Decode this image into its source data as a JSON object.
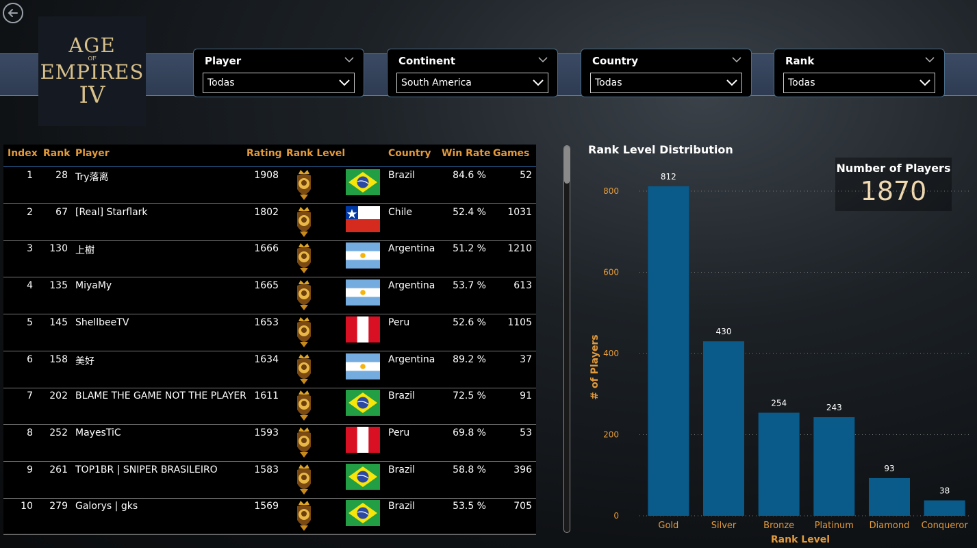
{
  "logo": {
    "line1": "AGE",
    "line2": "OF",
    "line3": "EMPIRES",
    "line4": "IV"
  },
  "filters": [
    {
      "title": "Player",
      "value": "Todas"
    },
    {
      "title": "Continent",
      "value": "South America"
    },
    {
      "title": "Country",
      "value": "Todas"
    },
    {
      "title": "Rank",
      "value": "Todas"
    }
  ],
  "table": {
    "headers": [
      "Index",
      "Rank",
      "Player",
      "Rating",
      "Rank Level",
      "Country",
      "Win Rate",
      "Games"
    ],
    "rows": [
      {
        "index": "1",
        "rank": "28",
        "player": "Try落离",
        "rating": "1908",
        "flag": "brazil",
        "country": "Brazil",
        "win_rate": "84.6 %",
        "games": "52"
      },
      {
        "index": "2",
        "rank": "67",
        "player": "[Real] Starflark",
        "rating": "1802",
        "flag": "chile",
        "country": "Chile",
        "win_rate": "52.4 %",
        "games": "1031"
      },
      {
        "index": "3",
        "rank": "130",
        "player": "上樹",
        "rating": "1666",
        "flag": "argentina",
        "country": "Argentina",
        "win_rate": "51.2 %",
        "games": "1210"
      },
      {
        "index": "4",
        "rank": "135",
        "player": "MiyaMy",
        "rating": "1665",
        "flag": "argentina",
        "country": "Argentina",
        "win_rate": "53.7 %",
        "games": "613"
      },
      {
        "index": "5",
        "rank": "145",
        "player": "ShellbeeTV",
        "rating": "1653",
        "flag": "peru",
        "country": "Peru",
        "win_rate": "52.6 %",
        "games": "1105"
      },
      {
        "index": "6",
        "rank": "158",
        "player": "美好",
        "rating": "1634",
        "flag": "argentina",
        "country": "Argentina",
        "win_rate": "89.2 %",
        "games": "37"
      },
      {
        "index": "7",
        "rank": "202",
        "player": "BLAME THE GAME NOT THE PLAYER",
        "rating": "1611",
        "flag": "brazil",
        "country": "Brazil",
        "win_rate": "72.5 %",
        "games": "91"
      },
      {
        "index": "8",
        "rank": "252",
        "player": "MayesTiC",
        "rating": "1593",
        "flag": "peru",
        "country": "Peru",
        "win_rate": "69.8 %",
        "games": "53"
      },
      {
        "index": "9",
        "rank": "261",
        "player": "TOP1BR | SNIPER BRASILEIRO",
        "rating": "1583",
        "flag": "brazil",
        "country": "Brazil",
        "win_rate": "58.8 %",
        "games": "396"
      },
      {
        "index": "10",
        "rank": "279",
        "player": "Galorys | gks",
        "rating": "1569",
        "flag": "brazil",
        "country": "Brazil",
        "win_rate": "53.5 %",
        "games": "705"
      }
    ]
  },
  "kpi": {
    "label": "Number of Players",
    "value": "1870"
  },
  "chart_data": {
    "type": "bar",
    "title": "Rank Level Distribution",
    "xlabel": "Rank Level",
    "ylabel": "# of Players",
    "categories": [
      "Gold",
      "Silver",
      "Bronze",
      "Platinum",
      "Diamond",
      "Conqueror"
    ],
    "values": [
      812,
      430,
      254,
      243,
      93,
      38
    ],
    "ylim": [
      0,
      800
    ],
    "yticks": [
      0,
      200,
      400,
      600,
      800
    ],
    "bar_color": "#0a5a8a",
    "tick_color": "#e39a3b",
    "grid": true
  },
  "colors": {
    "header_text": "#e39a3b",
    "accent": "#2f6fae"
  }
}
